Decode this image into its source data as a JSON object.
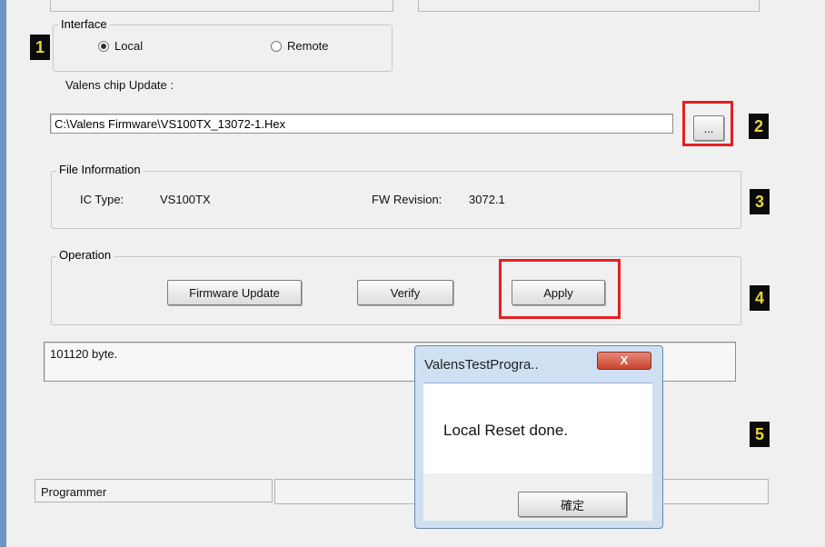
{
  "interface": {
    "legend": "Interface",
    "local_label": "Local",
    "remote_label": "Remote",
    "selected": "Local"
  },
  "chip_update": {
    "label": "Valens chip Update :",
    "path_value": "C:\\Valens Firmware\\VS100TX_13072-1.Hex",
    "browse_label": "..."
  },
  "file_info": {
    "legend": "File Information",
    "ic_type_label": "IC Type:",
    "ic_type_value": "VS100TX",
    "fw_revision_label": "FW Revision:",
    "fw_revision_value": "3072.1"
  },
  "operation": {
    "legend": "Operation",
    "firmware_update_label": "Firmware Update",
    "verify_label": "Verify",
    "apply_label": "Apply"
  },
  "log": {
    "text": "101120 byte."
  },
  "status_bar": {
    "programmer_label": "Programmer"
  },
  "markers": [
    "1",
    "2",
    "3",
    "4",
    "5"
  ],
  "dialog": {
    "title": "ValensTestProgra..",
    "close_label": "X",
    "message": "Local Reset done.",
    "ok_label": "確定"
  },
  "colors": {
    "highlight_red": "#e42023",
    "marker_bg": "#0b0b0b",
    "marker_fg": "#e8d63a"
  }
}
